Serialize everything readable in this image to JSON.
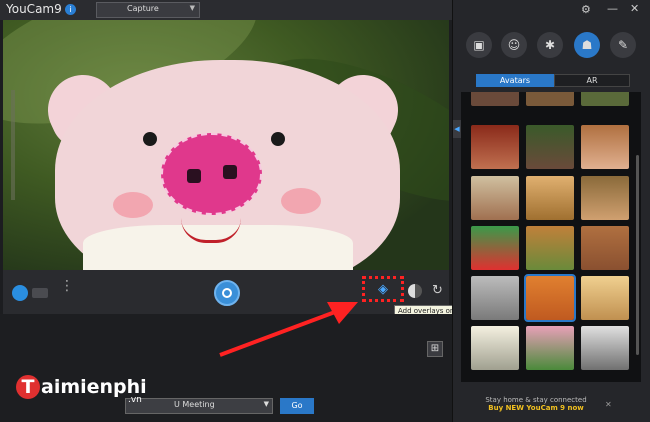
{
  "app": {
    "title": "YouCam9",
    "info": "i",
    "mode": "Capture"
  },
  "window": {
    "gear": "⚙",
    "min": "—",
    "close": "✕"
  },
  "controls": {
    "more": "⋮",
    "overlay_icon": "◈",
    "refresh": "↻",
    "tooltip": "Add overlays on the webcam video"
  },
  "lower": {
    "meeting": "U Meeting",
    "go": "Go",
    "grid": "⊞"
  },
  "logo": {
    "t": "T",
    "name": "aimienphi",
    "vn": ".vn"
  },
  "rpanel": {
    "tools": [
      "▣",
      "☺",
      "✱",
      "☗",
      "✎"
    ],
    "tabs": [
      "Avatars",
      "AR"
    ],
    "collapse": "◀",
    "promo_line1": "Stay home & stay connected",
    "promo_line2": "Buy NEW YouCam 9 now",
    "promo_close": "✕"
  },
  "colors": {
    "accent": "#2a78c8",
    "annotation": "#ff2222"
  }
}
